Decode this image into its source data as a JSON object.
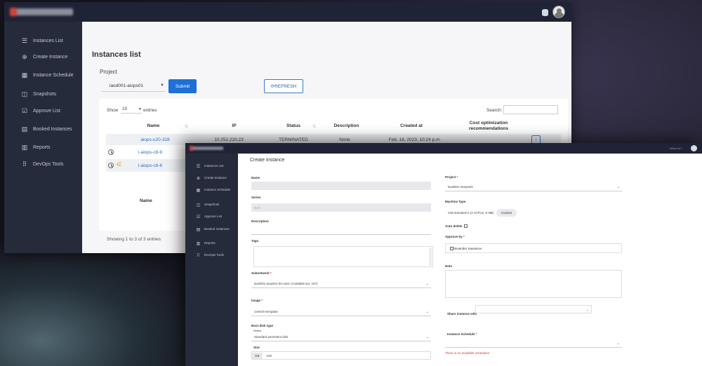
{
  "window1": {
    "sidebar": [
      {
        "icon": "list-icon",
        "glyph": "☰",
        "label": "Instances List"
      },
      {
        "icon": "add-circle-icon",
        "glyph": "⊕",
        "label": "Create Instance"
      },
      {
        "icon": "calendar-icon",
        "glyph": "▦",
        "label": "Instance Schedule"
      },
      {
        "icon": "camera-icon",
        "glyph": "◫",
        "label": "Snapshots"
      },
      {
        "icon": "check-square-icon",
        "glyph": "☑",
        "label": "Approve List"
      },
      {
        "icon": "document-icon",
        "glyph": "▤",
        "label": "Booked Instances"
      },
      {
        "icon": "bar-chart-icon",
        "glyph": "▥",
        "label": "Reports"
      },
      {
        "icon": "grid-icon",
        "glyph": "⠿",
        "label": "DevOps Tools"
      }
    ],
    "page_title": "Instances list",
    "project_label": "Project",
    "project_value": "laod001-aiops01",
    "submit_label": "Submit",
    "refresh_label": "⟳REFRESH",
    "show_label": "Show",
    "entries_value": "10",
    "entries_label": "entries",
    "search_label": "Search:",
    "columns": [
      "Name",
      "IP",
      "Status",
      "Description",
      "Created at",
      "Cost optimization recommendations"
    ],
    "rows": [
      {
        "name": "aiops-u20-328",
        "ip": "10.252.220.23",
        "status": "TERMINATED",
        "description": "None",
        "created": "Feb. 16, 2023, 10:24 p.m."
      },
      {
        "name": "l-aiops-c8-9"
      },
      {
        "name": "l-aiops-c8-8"
      }
    ],
    "kebab_label": "⋮",
    "footer_name": "Name",
    "showing": "Showing 1 to 3 of 3 entries"
  },
  "window2": {
    "who": "Who's in?",
    "sidebar": [
      {
        "icon": "list-icon",
        "glyph": "☰",
        "label": "Instances List"
      },
      {
        "icon": "add-circle-icon",
        "glyph": "⊕",
        "label": "Create Instance"
      },
      {
        "icon": "calendar-icon",
        "glyph": "▦",
        "label": "Instance Schedule"
      },
      {
        "icon": "camera-icon",
        "glyph": "◫",
        "label": "Snapshots"
      },
      {
        "icon": "check-square-icon",
        "glyph": "☑",
        "label": "Approve List"
      },
      {
        "icon": "document-icon",
        "glyph": "▤",
        "label": "Booked Instances"
      },
      {
        "icon": "bar-chart-icon",
        "glyph": "▥",
        "label": "Reports"
      },
      {
        "icon": "grid-icon",
        "glyph": "⠿",
        "label": "DevOps Tools"
      }
    ],
    "title": "Create Instance",
    "left": {
      "name_label": "Name",
      "series_label": "Series",
      "series_value": "N1S",
      "description_label": "Description",
      "tags_label": "Tags",
      "subnetwork_label": "Subnetwork",
      "subnetwork_value": "laod001-aiops01-02-use1 (Available ips: 167)",
      "image_label": "Image",
      "image_value": "centOS-template",
      "boot_disk_label": "Boot disk type",
      "boot_disk_sub": "Select",
      "boot_disk_value": "Standard persistent disk",
      "size_label": "Size",
      "size_unit": "GB",
      "size_value": "100"
    },
    "right": {
      "project_label": "Project",
      "project_value": "laod001-netops01",
      "machine_label": "Machine Type",
      "machine_value": "n2d-standard-2 (2 vCPUs, 8 GB)",
      "custom_label": "Custom",
      "auto_delete_label": "Auto delete",
      "approved_by_label": "Approve by",
      "approver_value": "Alexander Sasaimov",
      "note_label": "Note",
      "share_label": "Share instance with",
      "schedule_label": "Instance Schedule",
      "schedule_error": "There is no available schedules"
    }
  }
}
